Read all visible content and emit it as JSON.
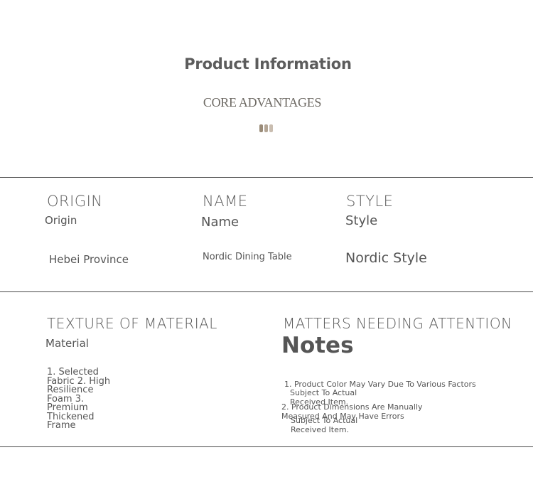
{
  "header": {
    "title": "Product Information",
    "subtitle": "CORE ADVANTAGES",
    "dot_colors": [
      "#9a8b78",
      "#b3a595",
      "#c9bdb0"
    ]
  },
  "specs": {
    "origin": {
      "caption": "ORIGIN",
      "label": "Origin",
      "value": "Hebei Province"
    },
    "name": {
      "caption": "NAME",
      "label": "Name",
      "value": "Nordic Dining Table"
    },
    "style": {
      "caption": "STYLE",
      "label": "Style",
      "value": "Nordic Style"
    }
  },
  "material": {
    "caption": "TEXTURE OF MATERIAL",
    "label": "Material",
    "lines": [
      "1. Selected",
      "Fabric 2. High",
      "Resilience",
      "Foam 3.",
      "Premium",
      "Thickened",
      "Frame"
    ]
  },
  "notes": {
    "caption": "MATTERS NEEDING ATTENTION",
    "title": "Notes",
    "lines": [
      "1. Product Color May Vary Due To Various Factors",
      "Subject To Actual",
      "Received Item.",
      "2. Product Dimensions Are Manually",
      "Measured And May Have Errors",
      "Subject To Actual",
      "Received Item."
    ]
  }
}
